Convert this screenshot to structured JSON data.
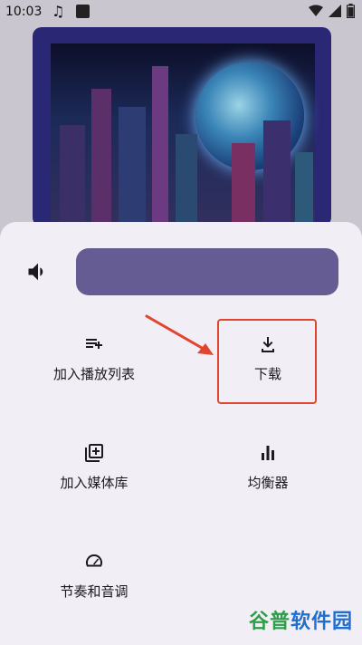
{
  "status": {
    "time": "10:03"
  },
  "volume": {
    "level": 1.0
  },
  "menu": {
    "add_to_playlist": "加入播放列表",
    "download": "下载",
    "add_to_library": "加入媒体库",
    "equalizer": "均衡器",
    "tempo_pitch": "节奏和音调"
  },
  "watermark": {
    "part1": "谷普",
    "part2": "软件园"
  },
  "colors": {
    "accent": "#655c93",
    "highlight": "#e2452f",
    "sheet": "#f1eef5"
  }
}
